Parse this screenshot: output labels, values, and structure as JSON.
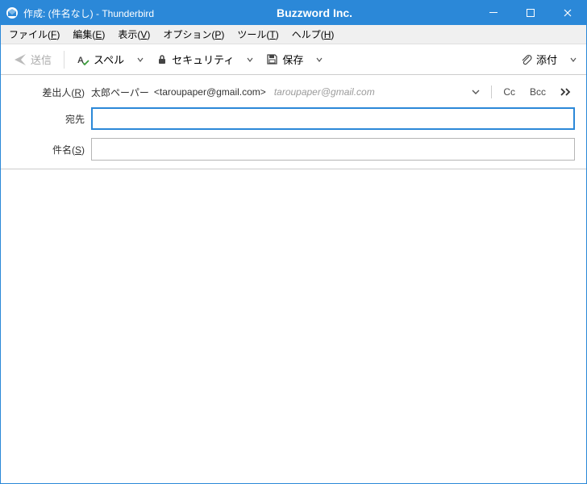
{
  "titlebar": {
    "title": "作成: (件名なし) - Thunderbird",
    "brand": "Buzzword Inc."
  },
  "menubar": {
    "file": {
      "pre": "ファイル(",
      "u": "F",
      "post": ")"
    },
    "edit": {
      "pre": "編集(",
      "u": "E",
      "post": ")"
    },
    "view": {
      "pre": "表示(",
      "u": "V",
      "post": ")"
    },
    "options": {
      "pre": "オプション(",
      "u": "P",
      "post": ")"
    },
    "tools": {
      "pre": "ツール(",
      "u": "T",
      "post": ")"
    },
    "help": {
      "pre": "ヘルプ(",
      "u": "H",
      "post": ")"
    }
  },
  "toolbar": {
    "send": "送信",
    "spell": "スペル",
    "security": "セキュリティ",
    "save": "保存",
    "attach": "添付"
  },
  "addressing": {
    "from_label": {
      "pre": "差出人(",
      "u": "R",
      "post": ")"
    },
    "from_name": "太郎ペーパー",
    "from_email": "<taroupaper@gmail.com>",
    "from_placeholder": "taroupaper@gmail.com",
    "to_label": "宛先",
    "to_value": "",
    "subject_label": {
      "pre": "件名(",
      "u": "S",
      "post": ")"
    },
    "subject_value": "",
    "cc": "Cc",
    "bcc": "Bcc"
  },
  "body": ""
}
